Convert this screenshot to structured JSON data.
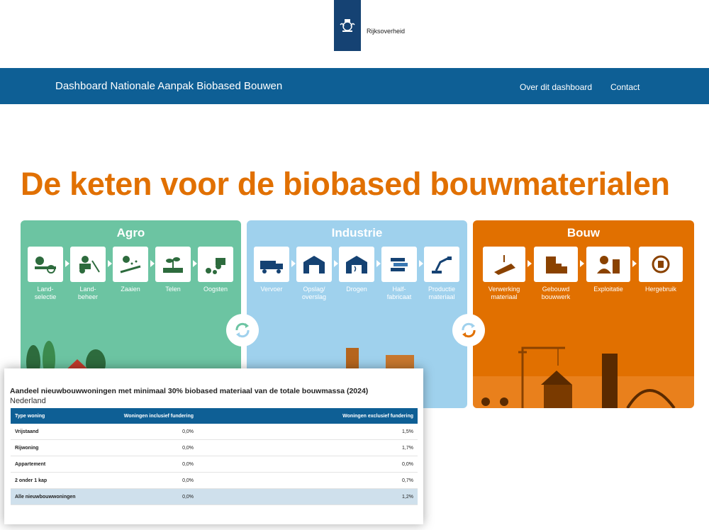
{
  "header": {
    "logo_text": "Rijksoverheid"
  },
  "nav": {
    "title": "Dashboard Nationale Aanpak Biobased Bouwen",
    "links": [
      "Over dit dashboard",
      "Contact"
    ]
  },
  "headline": "De keten voor de biobased bouwmaterialen",
  "colors": {
    "agro": "#6cc4a2",
    "industrie": "#9fd1ed",
    "bouw": "#e17000",
    "nav": "#0e5f95",
    "headline": "#e17000"
  },
  "chain": {
    "agro": {
      "title": "Agro",
      "steps": [
        "Land-\nselectie",
        "Land-\nbeheer",
        "Zaaien",
        "Telen",
        "Oogsten"
      ]
    },
    "industrie": {
      "title": "Industrie",
      "steps": [
        "Vervoer",
        "Opslag/\noverslag",
        "Drogen",
        "Half-\nfabricaat",
        "Productie\nmateriaal"
      ]
    },
    "bouw": {
      "title": "Bouw",
      "steps": [
        "Verwerking\nmateriaal",
        "Gebouwd\nbouwwerk",
        "Exploitatie",
        "Hergebruik"
      ]
    }
  },
  "overlay": {
    "title": "Aandeel nieuwbouwwoningen met minimaal 30% biobased materiaal van de totale bouwmassa (2024)",
    "subtitle": "Nederland",
    "columns": [
      "Type woning",
      "Woningen inclusief fundering",
      "Woningen exclusief fundering"
    ],
    "rows": [
      [
        "Vrijstaand",
        "0,0%",
        "1,5%"
      ],
      [
        "Rijwoning",
        "0,0%",
        "1,7%"
      ],
      [
        "Appartement",
        "0,0%",
        "0,0%"
      ],
      [
        "2 onder 1 kap",
        "0,0%",
        "0,7%"
      ],
      [
        "Alle nieuwbouwwoningen",
        "0,0%",
        "1,2%"
      ]
    ]
  }
}
